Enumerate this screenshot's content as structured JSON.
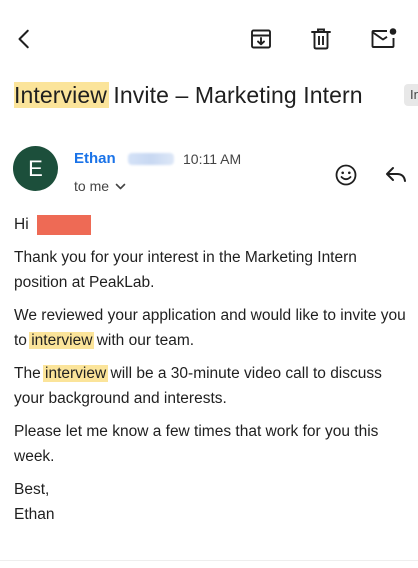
{
  "subject": {
    "highlight": "Interview",
    "rest": " Invite – Marketing Intern",
    "label_chip": "Inb"
  },
  "sender": {
    "avatar_initial": "E",
    "name": "Ethan",
    "time": "10:11 AM",
    "recipients": "to me"
  },
  "body": {
    "greeting": "Hi",
    "p1": "Thank you for your interest in the Marketing Intern position at PeakLab.",
    "p2_a": "We reviewed your application and would like to invite you to ",
    "p2_hl": "interview",
    "p2_b": " with our team.",
    "p3_a": "The ",
    "p3_hl": "interview",
    "p3_b": " will be a 30-minute video call to discuss your background and interests.",
    "p4": "Please let me know a few times that work for you this week.",
    "signoff": "Best,",
    "signature": "Ethan"
  },
  "icons": {
    "back": "back-arrow-icon",
    "archive": "archive-icon",
    "delete": "trash-icon",
    "mark_unread": "mail-icon",
    "emoji": "emoji-icon",
    "reply": "reply-icon",
    "expand": "chevron-down-icon"
  },
  "colors": {
    "accent": "#1a73e8",
    "avatar_bg": "#1c4f3b",
    "highlight": "#fbe49a",
    "redaction": "#ee6a55"
  }
}
